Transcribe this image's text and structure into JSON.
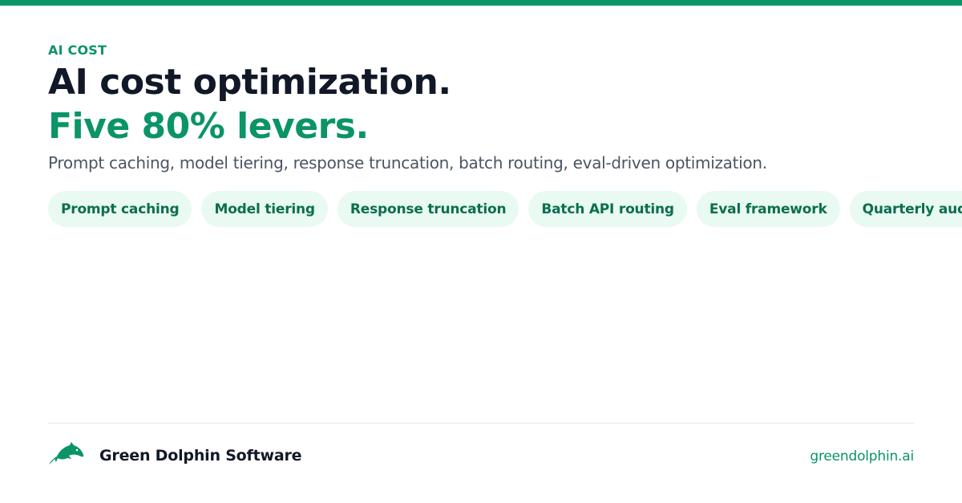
{
  "eyebrow": "AI COST",
  "title": "AI cost optimization.",
  "title_accent": "Five 80% levers.",
  "subtitle": "Prompt caching, model tiering, response truncation, batch routing, eval-driven optimization.",
  "chips": [
    "Prompt caching",
    "Model tiering",
    "Response truncation",
    "Batch API routing",
    "Eval framework",
    "Quarterly audit"
  ],
  "footer": {
    "logo_icon": "dolphin-icon",
    "company": "Green Dolphin Software",
    "site": "greendolphin.ai"
  },
  "colors": {
    "accent": "#0a9467",
    "heading": "#111827",
    "body": "#4b5563",
    "chip_bg": "#e8faf2",
    "chip_text": "#0b6e4f"
  }
}
